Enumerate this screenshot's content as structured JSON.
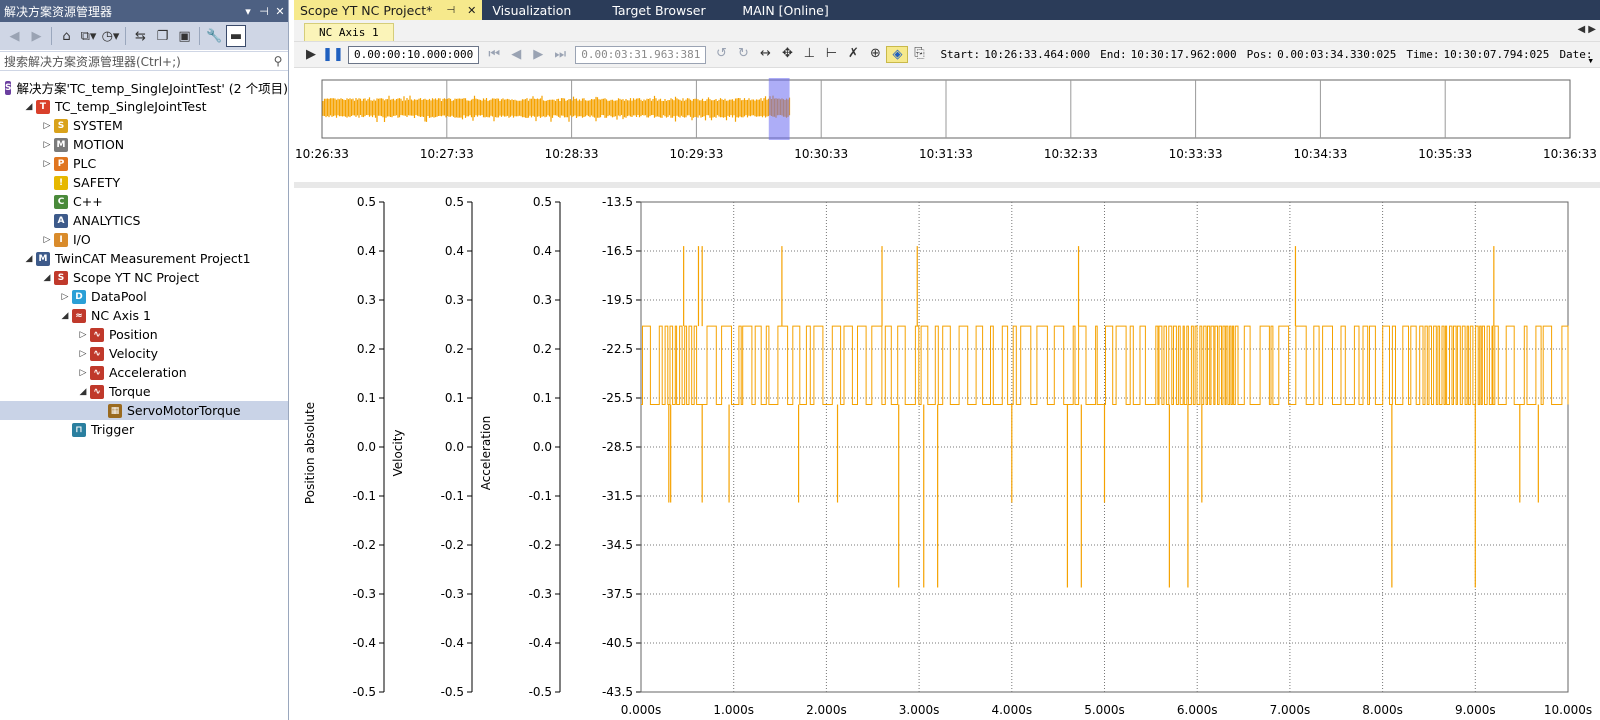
{
  "explorer": {
    "title": "解决方案资源管理器",
    "title_buttons": [
      "▾",
      "⊣",
      "✕"
    ],
    "toolbar": [
      {
        "icon": "back-arrow-icon",
        "glyph": "◀",
        "dim": true
      },
      {
        "icon": "forward-arrow-icon",
        "glyph": "▶",
        "dim": true
      },
      {
        "icon": "home-icon",
        "glyph": "⌂"
      },
      {
        "icon": "switch-views-icon",
        "glyph": "⧉▾"
      },
      {
        "icon": "pending-changes-icon",
        "glyph": "◷▾"
      },
      {
        "icon": "sync-icon",
        "glyph": "⇆"
      },
      {
        "icon": "collapse-all-icon",
        "glyph": "❐"
      },
      {
        "icon": "show-all-files-icon",
        "glyph": "▣"
      },
      {
        "icon": "properties-wrench-icon",
        "glyph": "🔧"
      },
      {
        "icon": "preview-icon",
        "glyph": "▬",
        "selected": true
      }
    ],
    "search_placeholder": "搜索解决方案资源管理器(Ctrl+;)",
    "tree": [
      {
        "label": "解决方案'TC_temp_SingleJointTest' (2 个项目)",
        "indent": 0,
        "expander": "",
        "icon": "solution-icon",
        "color": "#6b3fa0",
        "glyph": "S"
      },
      {
        "label": "TC_temp_SingleJointTest",
        "indent": 1,
        "expander": "◢",
        "icon": "twincat-project-icon",
        "color": "#d9402b",
        "glyph": "T"
      },
      {
        "label": "SYSTEM",
        "indent": 2,
        "expander": "▷",
        "icon": "system-icon",
        "color": "#d9a21b",
        "glyph": "S"
      },
      {
        "label": "MOTION",
        "indent": 2,
        "expander": "▷",
        "icon": "motion-icon",
        "color": "#7a7a7a",
        "glyph": "M"
      },
      {
        "label": "PLC",
        "indent": 2,
        "expander": "▷",
        "icon": "plc-icon",
        "color": "#e0751f",
        "glyph": "P"
      },
      {
        "label": "SAFETY",
        "indent": 2,
        "expander": "",
        "icon": "safety-icon",
        "color": "#e6b800",
        "glyph": "!"
      },
      {
        "label": "C++",
        "indent": 2,
        "expander": "",
        "icon": "cpp-icon",
        "color": "#4a8a3a",
        "glyph": "C"
      },
      {
        "label": "ANALYTICS",
        "indent": 2,
        "expander": "",
        "icon": "analytics-icon",
        "color": "#3d5a8a",
        "glyph": "A"
      },
      {
        "label": "I/O",
        "indent": 2,
        "expander": "▷",
        "icon": "io-icon",
        "color": "#d98b2b",
        "glyph": "I"
      },
      {
        "label": "TwinCAT Measurement Project1",
        "indent": 1,
        "expander": "◢",
        "icon": "measurement-project-icon",
        "color": "#3d5a8a",
        "glyph": "M"
      },
      {
        "label": "Scope YT NC Project",
        "indent": 2,
        "expander": "◢",
        "icon": "scope-project-icon",
        "color": "#c0392b",
        "glyph": "S"
      },
      {
        "label": "DataPool",
        "indent": 3,
        "expander": "▷",
        "icon": "datapool-icon",
        "color": "#2a9fd6",
        "glyph": "D"
      },
      {
        "label": "NC Axis 1",
        "indent": 3,
        "expander": "◢",
        "icon": "chart-icon",
        "color": "#c0392b",
        "glyph": "≈"
      },
      {
        "label": "Position",
        "indent": 4,
        "expander": "▷",
        "icon": "axis-icon",
        "color": "#c0392b",
        "glyph": "∿"
      },
      {
        "label": "Velocity",
        "indent": 4,
        "expander": "▷",
        "icon": "axis-icon",
        "color": "#c0392b",
        "glyph": "∿"
      },
      {
        "label": "Acceleration",
        "indent": 4,
        "expander": "▷",
        "icon": "axis-icon",
        "color": "#c0392b",
        "glyph": "∿"
      },
      {
        "label": "Torque",
        "indent": 4,
        "expander": "◢",
        "icon": "axis-icon",
        "color": "#c0392b",
        "glyph": "∿"
      },
      {
        "label": "ServoMotorTorque",
        "indent": 5,
        "expander": "",
        "icon": "channel-icon",
        "color": "#9a6a1f",
        "glyph": "▦",
        "selected": true
      },
      {
        "label": "Trigger",
        "indent": 3,
        "expander": "",
        "icon": "trigger-icon",
        "color": "#2a7f9f",
        "glyph": "⊓"
      }
    ]
  },
  "doc_tabs": [
    {
      "label": "Scope YT NC Project*",
      "active": true,
      "pin": "⊣",
      "close": "✕"
    },
    {
      "label": "Visualization",
      "active": false
    },
    {
      "label": "Target Browser",
      "active": false
    },
    {
      "label": "MAIN [Online]",
      "active": false
    }
  ],
  "inner_tab": "NC Axis 1",
  "inner_arrows": "◀ ▶",
  "scope_toolbar": {
    "play": "▶",
    "pause": "❚❚",
    "interval": "0.00:00:10.000:000",
    "nav_first": "⏮",
    "nav_prev": "◀",
    "nav_next": "▶",
    "nav_last": "⏭",
    "position_field": "0.00:03:31.963:381",
    "tools": [
      {
        "icon": "undo-icon",
        "glyph": "↺"
      },
      {
        "icon": "redo-icon",
        "glyph": "↻"
      },
      {
        "icon": "pan-horizontal-icon",
        "glyph": "↔"
      },
      {
        "icon": "pan-icon",
        "glyph": "✥"
      },
      {
        "icon": "zoom-x-icon",
        "glyph": "⊥"
      },
      {
        "icon": "zoom-y-icon",
        "glyph": "⊢"
      },
      {
        "icon": "cursor-remove-icon",
        "glyph": "✗"
      },
      {
        "icon": "zoom-max-icon",
        "glyph": "⊕"
      },
      {
        "icon": "overview-icon",
        "glyph": "◈",
        "highlight": true
      },
      {
        "icon": "export-icon",
        "glyph": "⎘"
      }
    ],
    "start_label": "Start:",
    "start_value": "10:26:33.464:000",
    "end_label": "End:",
    "end_value": "10:30:17.962:000",
    "pos_label": "Pos:",
    "pos_value": "0.00:03:34.330:025",
    "time_label": "Time:",
    "time_value": "10:30:07.794:025",
    "date_label": "Date:",
    "dropdown": "▾"
  },
  "colors": {
    "series": "#f5a200",
    "selection": "#6a6af0",
    "grid": "#777777",
    "title_bar": "#4d6082",
    "tab_active": "#f6e98c"
  },
  "chart_data": [
    {
      "type": "line",
      "name": "overview",
      "x_ticks": [
        "10:26:33",
        "10:27:33",
        "10:28:33",
        "10:29:33",
        "10:30:33",
        "10:31:33",
        "10:32:33",
        "10:33:33",
        "10:34:33",
        "10:35:33",
        "10:36:33"
      ],
      "data_range": [
        "10:26:33.464",
        "10:30:17.962"
      ],
      "selection_range": [
        "10:30:07.794",
        "10:30:17.794"
      ],
      "grid": true
    },
    {
      "type": "line",
      "name": "ServoMotorTorque",
      "axes": [
        {
          "label": "Position absolute",
          "ticks": [
            "0.5",
            "0.4",
            "0.3",
            "0.2",
            "0.1",
            "0.0",
            "-0.1",
            "-0.2",
            "-0.3",
            "-0.4",
            "-0.5"
          ],
          "ylim": [
            -0.5,
            0.5
          ]
        },
        {
          "label": "Velocity",
          "ticks": [
            "0.5",
            "0.4",
            "0.3",
            "0.2",
            "0.1",
            "0.0",
            "-0.1",
            "-0.2",
            "-0.3",
            "-0.4",
            "-0.5"
          ],
          "ylim": [
            -0.5,
            0.5
          ]
        },
        {
          "label": "Acceleration",
          "ticks": [
            "0.5",
            "0.4",
            "0.3",
            "0.2",
            "0.1",
            "0.0",
            "-0.1",
            "-0.2",
            "-0.3",
            "-0.4",
            "-0.5"
          ],
          "ylim": [
            -0.5,
            0.5
          ]
        },
        {
          "label": "",
          "ticks": [
            "-13.5",
            "-16.5",
            "-19.5",
            "-22.5",
            "-25.5",
            "-28.5",
            "-31.5",
            "-34.5",
            "-37.5",
            "-40.5",
            "-43.5"
          ],
          "ylim": [
            -43.5,
            -13.5
          ]
        }
      ],
      "x_ticks": [
        "0.000s",
        "1.000s",
        "2.000s",
        "3.000s",
        "4.000s",
        "5.000s",
        "6.000s",
        "7.000s",
        "8.000s",
        "9.000s",
        "10.000s"
      ],
      "xlim": [
        0,
        10
      ],
      "levels": [
        -21.1,
        -25.9
      ],
      "spikes_up": [
        [
          0.46,
          -16.2
        ],
        [
          0.62,
          -16.2
        ],
        [
          0.66,
          -16.2
        ],
        [
          1.52,
          -16.2
        ],
        [
          2.6,
          -16.2
        ],
        [
          2.98,
          -16.2
        ],
        [
          4.72,
          -16.2
        ],
        [
          7.06,
          -16.2
        ],
        [
          9.2,
          -16.2
        ]
      ],
      "spikes_down": [
        [
          0.3,
          -31.9
        ],
        [
          0.32,
          -31.9
        ],
        [
          0.66,
          -31.9
        ],
        [
          0.95,
          -31.9
        ],
        [
          1.7,
          -31.9
        ],
        [
          2.12,
          -31.9
        ],
        [
          2.78,
          -37.1
        ],
        [
          3.05,
          -37.1
        ],
        [
          3.2,
          -37.1
        ],
        [
          4.0,
          -31.9
        ],
        [
          4.6,
          -37.1
        ],
        [
          4.75,
          -37.1
        ],
        [
          5.0,
          -31.9
        ],
        [
          5.7,
          -37.1
        ],
        [
          5.9,
          -37.1
        ],
        [
          6.05,
          -31.9
        ],
        [
          8.1,
          -37.1
        ],
        [
          9.0,
          -37.1
        ],
        [
          9.48,
          -31.9
        ],
        [
          9.68,
          -31.9
        ]
      ],
      "grid": true,
      "legend": "none"
    }
  ]
}
